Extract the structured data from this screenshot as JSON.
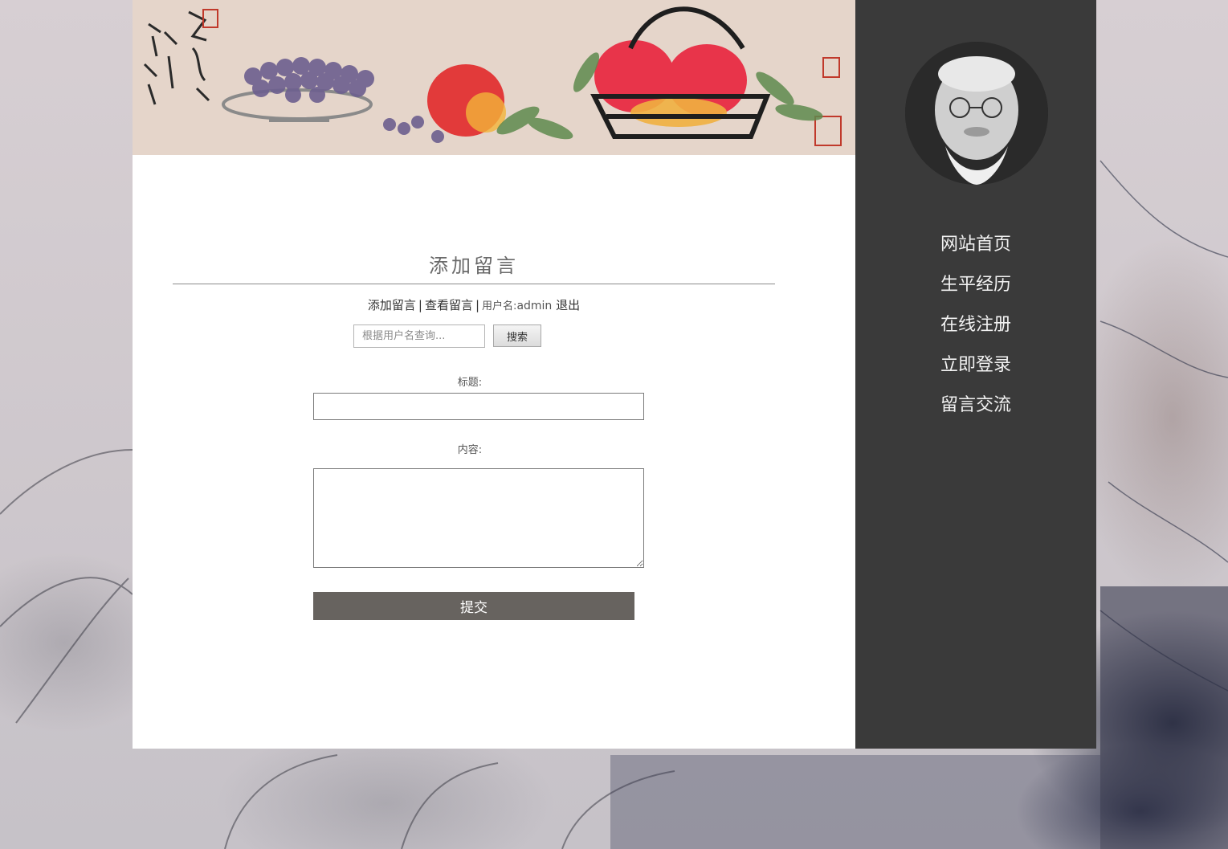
{
  "page": {
    "title": "添加留言"
  },
  "toolbar": {
    "add_link": "添加留言",
    "separator": "|",
    "view_link": "查看留言",
    "username_label": "用户名:",
    "username_value": "admin",
    "logout_link": "退出"
  },
  "search": {
    "placeholder": "根据用户名查询...",
    "button_label": "搜索"
  },
  "form": {
    "title_label": "标题:",
    "title_value": "",
    "content_label": "内容:",
    "content_value": "",
    "submit_label": "提交"
  },
  "sidebar": {
    "items": [
      {
        "label": "网站首页"
      },
      {
        "label": "生平经历"
      },
      {
        "label": "在线注册"
      },
      {
        "label": "立即登录"
      },
      {
        "label": "留言交流"
      }
    ]
  },
  "colors": {
    "sidebar_bg": "#3a3a3a",
    "submit_bg": "#67635f",
    "page_bg": "#ffffff"
  },
  "icons": {
    "avatar": "portrait-avatar",
    "banner": "fruit-painting-banner"
  }
}
